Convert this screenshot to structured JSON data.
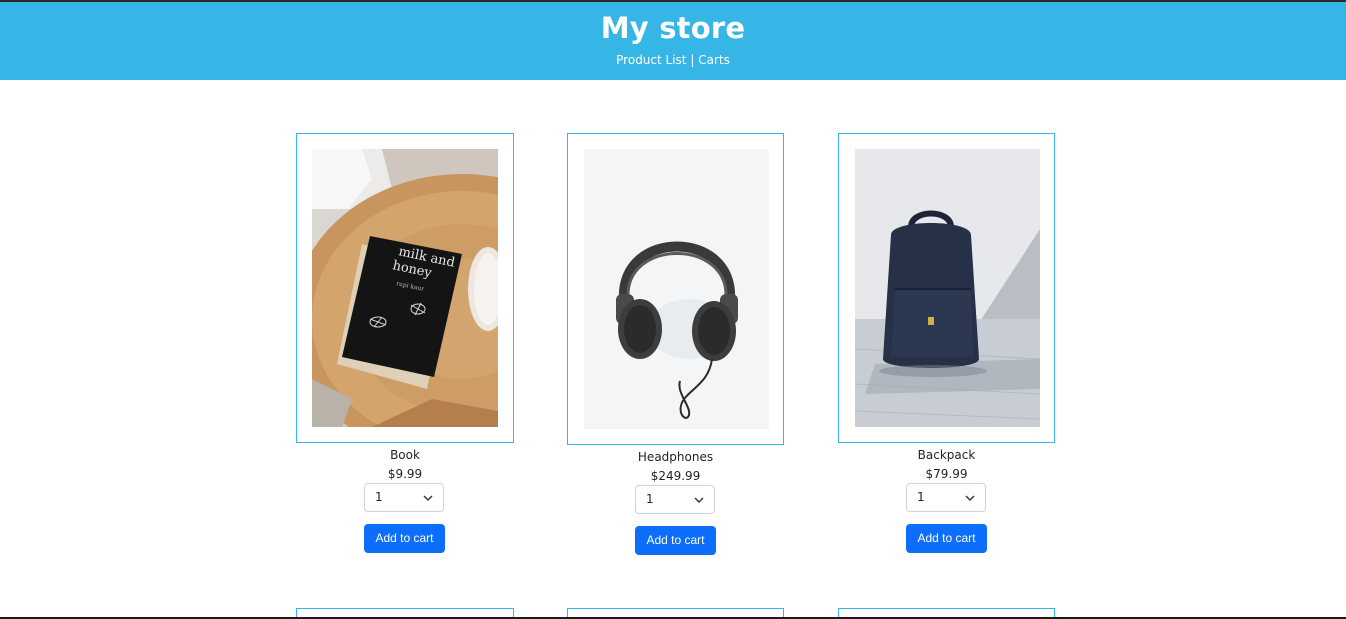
{
  "header": {
    "title": "My store",
    "nav": [
      {
        "label": "Product List"
      },
      {
        "separator": "|"
      },
      {
        "label": "Carts"
      }
    ]
  },
  "products": [
    {
      "name": "Book",
      "price": "$9.99",
      "quantity": "1",
      "button": "Add to cart",
      "image": "book-photo"
    },
    {
      "name": "Headphones",
      "price": "$249.99",
      "quantity": "1",
      "button": "Add to cart",
      "image": "headphones-photo"
    },
    {
      "name": "Backpack",
      "price": "$79.99",
      "quantity": "1",
      "button": "Add to cart",
      "image": "backpack-photo"
    }
  ],
  "colors": {
    "header": "#35b6e6",
    "button": "#0d6efd",
    "frame": "#35b6e6"
  }
}
